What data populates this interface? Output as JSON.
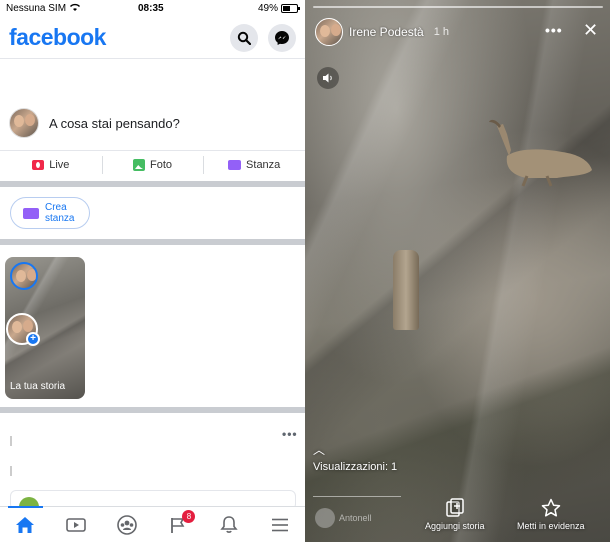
{
  "status_bar": {
    "carrier": "Nessuna SIM",
    "time": "08:35",
    "battery": "49%"
  },
  "header": {
    "logo": "facebook",
    "icons": [
      "search-icon",
      "messenger-icon"
    ]
  },
  "composer": {
    "prompt": "A cosa stai pensando?"
  },
  "actions": [
    {
      "label": "Live",
      "icon": "live-video-icon",
      "color": "#f02849"
    },
    {
      "label": "Foto",
      "icon": "photo-icon",
      "color": "#45bd62"
    },
    {
      "label": "Stanza",
      "icon": "room-icon",
      "color": "#9360f7"
    }
  ],
  "rooms": {
    "create_label": "Crea stanza"
  },
  "stories": {
    "my_story_label": "La tua storia"
  },
  "tab_bar": {
    "tabs": [
      {
        "icon": "home-icon",
        "active": true
      },
      {
        "icon": "video-icon"
      },
      {
        "icon": "groups-icon"
      },
      {
        "icon": "pages-flag-icon",
        "badge": "8"
      },
      {
        "icon": "bell-icon"
      },
      {
        "icon": "menu-icon"
      }
    ]
  },
  "story_viewer": {
    "user_name": "Irene Podestà",
    "time_ago": "1 h",
    "views_label": "Visualizzazioni: 1",
    "viewer_name": "Antonell",
    "add_story_label": "Aggiungi storia",
    "highlight_label": "Metti in evidenza"
  },
  "colors": {
    "brand": "#1877f2",
    "badge": "#e41e3f"
  }
}
